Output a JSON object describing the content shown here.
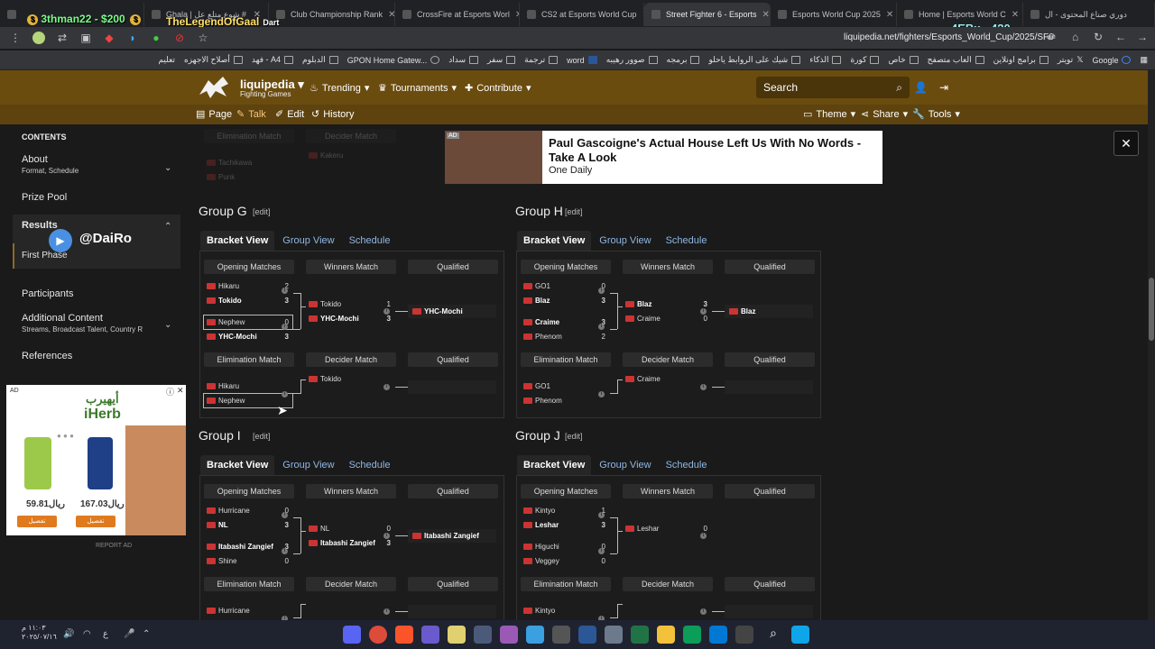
{
  "browser": {
    "tabs": [
      {
        "label": "Ghala | شوع متلع عل #"
      },
      {
        "label": "Club Championship Rank"
      },
      {
        "label": "CrossFire at Esports Worl"
      },
      {
        "label": "CS2 at Esports World Cup"
      },
      {
        "label": "Street Fighter 6 - Esports"
      },
      {
        "label": "Esports World Cup 2025"
      },
      {
        "label": "Home | Esports World C"
      },
      {
        "label": "دوري صناع المحتوى - ال"
      }
    ],
    "url": "liquipedia.net/fighters/Esports_World_Cup/2025/SF6",
    "bookmarks": [
      "Google",
      "تويتر",
      "برامج اونلاين",
      "العاب متصفح",
      "خاص",
      "كورة",
      "الذكاء",
      "شيك على الروابط ياحلو",
      "برمجه",
      "صوور رهيبه",
      "word",
      "ترجمة",
      "سفر",
      "سداد",
      "GPON Home Gatew...",
      "الدبلوم",
      "فهد - A4",
      "أصلاح الاجهزه",
      "تعليم"
    ]
  },
  "overlay": {
    "line1": "3thman22 - $200",
    "line2": "TheLegendOfGaal",
    "line2b": "Dart",
    "line3": "4EBx - 420",
    "handle": "@DaiRo"
  },
  "header": {
    "brand": "liquipedia",
    "brand_sub": "Fighting Games",
    "nav": [
      "Trending",
      "Tournaments",
      "Contribute"
    ],
    "search_placeholder": "Search",
    "subnav": [
      "Page",
      "Talk",
      "Edit",
      "History"
    ],
    "tools": [
      "Theme",
      "Share",
      "Tools"
    ]
  },
  "sidebar": {
    "contents_label": "CONTENTS",
    "items": [
      {
        "label": "About",
        "sub": "Format, Schedule"
      },
      {
        "label": "Prize Pool",
        "sub": ""
      },
      {
        "label": "Results",
        "sub": ""
      },
      {
        "label": "First Phase",
        "sub": ""
      },
      {
        "label": "Participants",
        "sub": ""
      },
      {
        "label": "Additional Content",
        "sub": "Streams, Broadcast Talent, Country R"
      },
      {
        "label": "References",
        "sub": ""
      }
    ]
  },
  "side_ad": {
    "label": "AD",
    "brand_ar": "أيهيرب",
    "brand": "iHerb",
    "price1": "59.81ريال",
    "price2": "167.03ريال",
    "button": "تفصيل",
    "report": "REPORT AD"
  },
  "top_ad": {
    "label": "AD",
    "headline": "Paul Gascoigne's Actual House Left Us With No Words - Take A Look",
    "source": "One Daily"
  },
  "faded": {
    "col1": "Elimination Match",
    "col2": "Decider Match",
    "team1": "Tachikawa",
    "team2": "Punk",
    "team3": "Kakeru"
  },
  "columns": {
    "opening": "Opening Matches",
    "winners": "Winners Match",
    "qualified": "Qualified",
    "elimination": "Elimination Match",
    "decider": "Decider Match"
  },
  "view_tabs": [
    "Bracket View",
    "Group View",
    "Schedule"
  ],
  "edit_label": "edit",
  "groups": [
    {
      "title": "Group G",
      "opening": [
        [
          {
            "name": "Hikaru",
            "score": "2",
            "win": false
          },
          {
            "name": "Tokido",
            "score": "3",
            "win": true
          }
        ],
        [
          {
            "name": "Nephew",
            "score": "0",
            "win": false
          },
          {
            "name": "YHC-Mochi",
            "score": "3",
            "win": true
          }
        ]
      ],
      "winners": [
        {
          "name": "Tokido",
          "score": "1",
          "win": false
        },
        {
          "name": "YHC-Mochi",
          "score": "3",
          "win": true
        }
      ],
      "qualified": "YHC-Mochi",
      "elimination": [
        {
          "name": "Hikaru",
          "score": "",
          "win": false
        },
        {
          "name": "Nephew",
          "score": "",
          "win": false
        }
      ],
      "decider": [
        {
          "name": "Tokido",
          "score": "",
          "win": false
        }
      ],
      "qualified2": ""
    },
    {
      "title": "Group H",
      "opening": [
        [
          {
            "name": "GO1",
            "score": "0",
            "win": false
          },
          {
            "name": "Blaz",
            "score": "3",
            "win": true
          }
        ],
        [
          {
            "name": "Craime",
            "score": "3",
            "win": true
          },
          {
            "name": "Phenom",
            "score": "2",
            "win": false
          }
        ]
      ],
      "winners": [
        {
          "name": "Blaz",
          "score": "3",
          "win": true
        },
        {
          "name": "Craime",
          "score": "0",
          "win": false
        }
      ],
      "qualified": "Blaz",
      "elimination": [
        {
          "name": "GO1",
          "score": "",
          "win": false
        },
        {
          "name": "Phenom",
          "score": "",
          "win": false
        }
      ],
      "decider": [
        {
          "name": "Craime",
          "score": "",
          "win": false
        }
      ],
      "qualified2": ""
    },
    {
      "title": "Group I",
      "opening": [
        [
          {
            "name": "Hurricane",
            "score": "0",
            "win": false
          },
          {
            "name": "NL",
            "score": "3",
            "win": true
          }
        ],
        [
          {
            "name": "Itabashi Zangief",
            "score": "3",
            "win": true
          },
          {
            "name": "Shine",
            "score": "0",
            "win": false
          }
        ]
      ],
      "winners": [
        {
          "name": "NL",
          "score": "0",
          "win": false
        },
        {
          "name": "Itabashi Zangief",
          "score": "3",
          "win": true
        }
      ],
      "qualified": "Itabashi Zangief",
      "elimination": [
        {
          "name": "Hurricane",
          "score": "",
          "win": false
        }
      ],
      "decider": [],
      "qualified2": ""
    },
    {
      "title": "Group J",
      "opening": [
        [
          {
            "name": "Kintyo",
            "score": "1",
            "win": false
          },
          {
            "name": "Leshar",
            "score": "3",
            "win": true
          }
        ],
        [
          {
            "name": "Higuchi",
            "score": "0",
            "win": false
          },
          {
            "name": "Veggey",
            "score": "0",
            "win": false
          }
        ]
      ],
      "winners": [
        {
          "name": "Leshar",
          "score": "0",
          "win": false
        }
      ],
      "qualified": "",
      "elimination": [
        {
          "name": "Kintyo",
          "score": "",
          "win": false
        }
      ],
      "decider": [],
      "qualified2": ""
    }
  ],
  "taskbar": {
    "time": "١١:٠٣ م",
    "date": "٢٠٢٥/٠٧/١٦"
  }
}
